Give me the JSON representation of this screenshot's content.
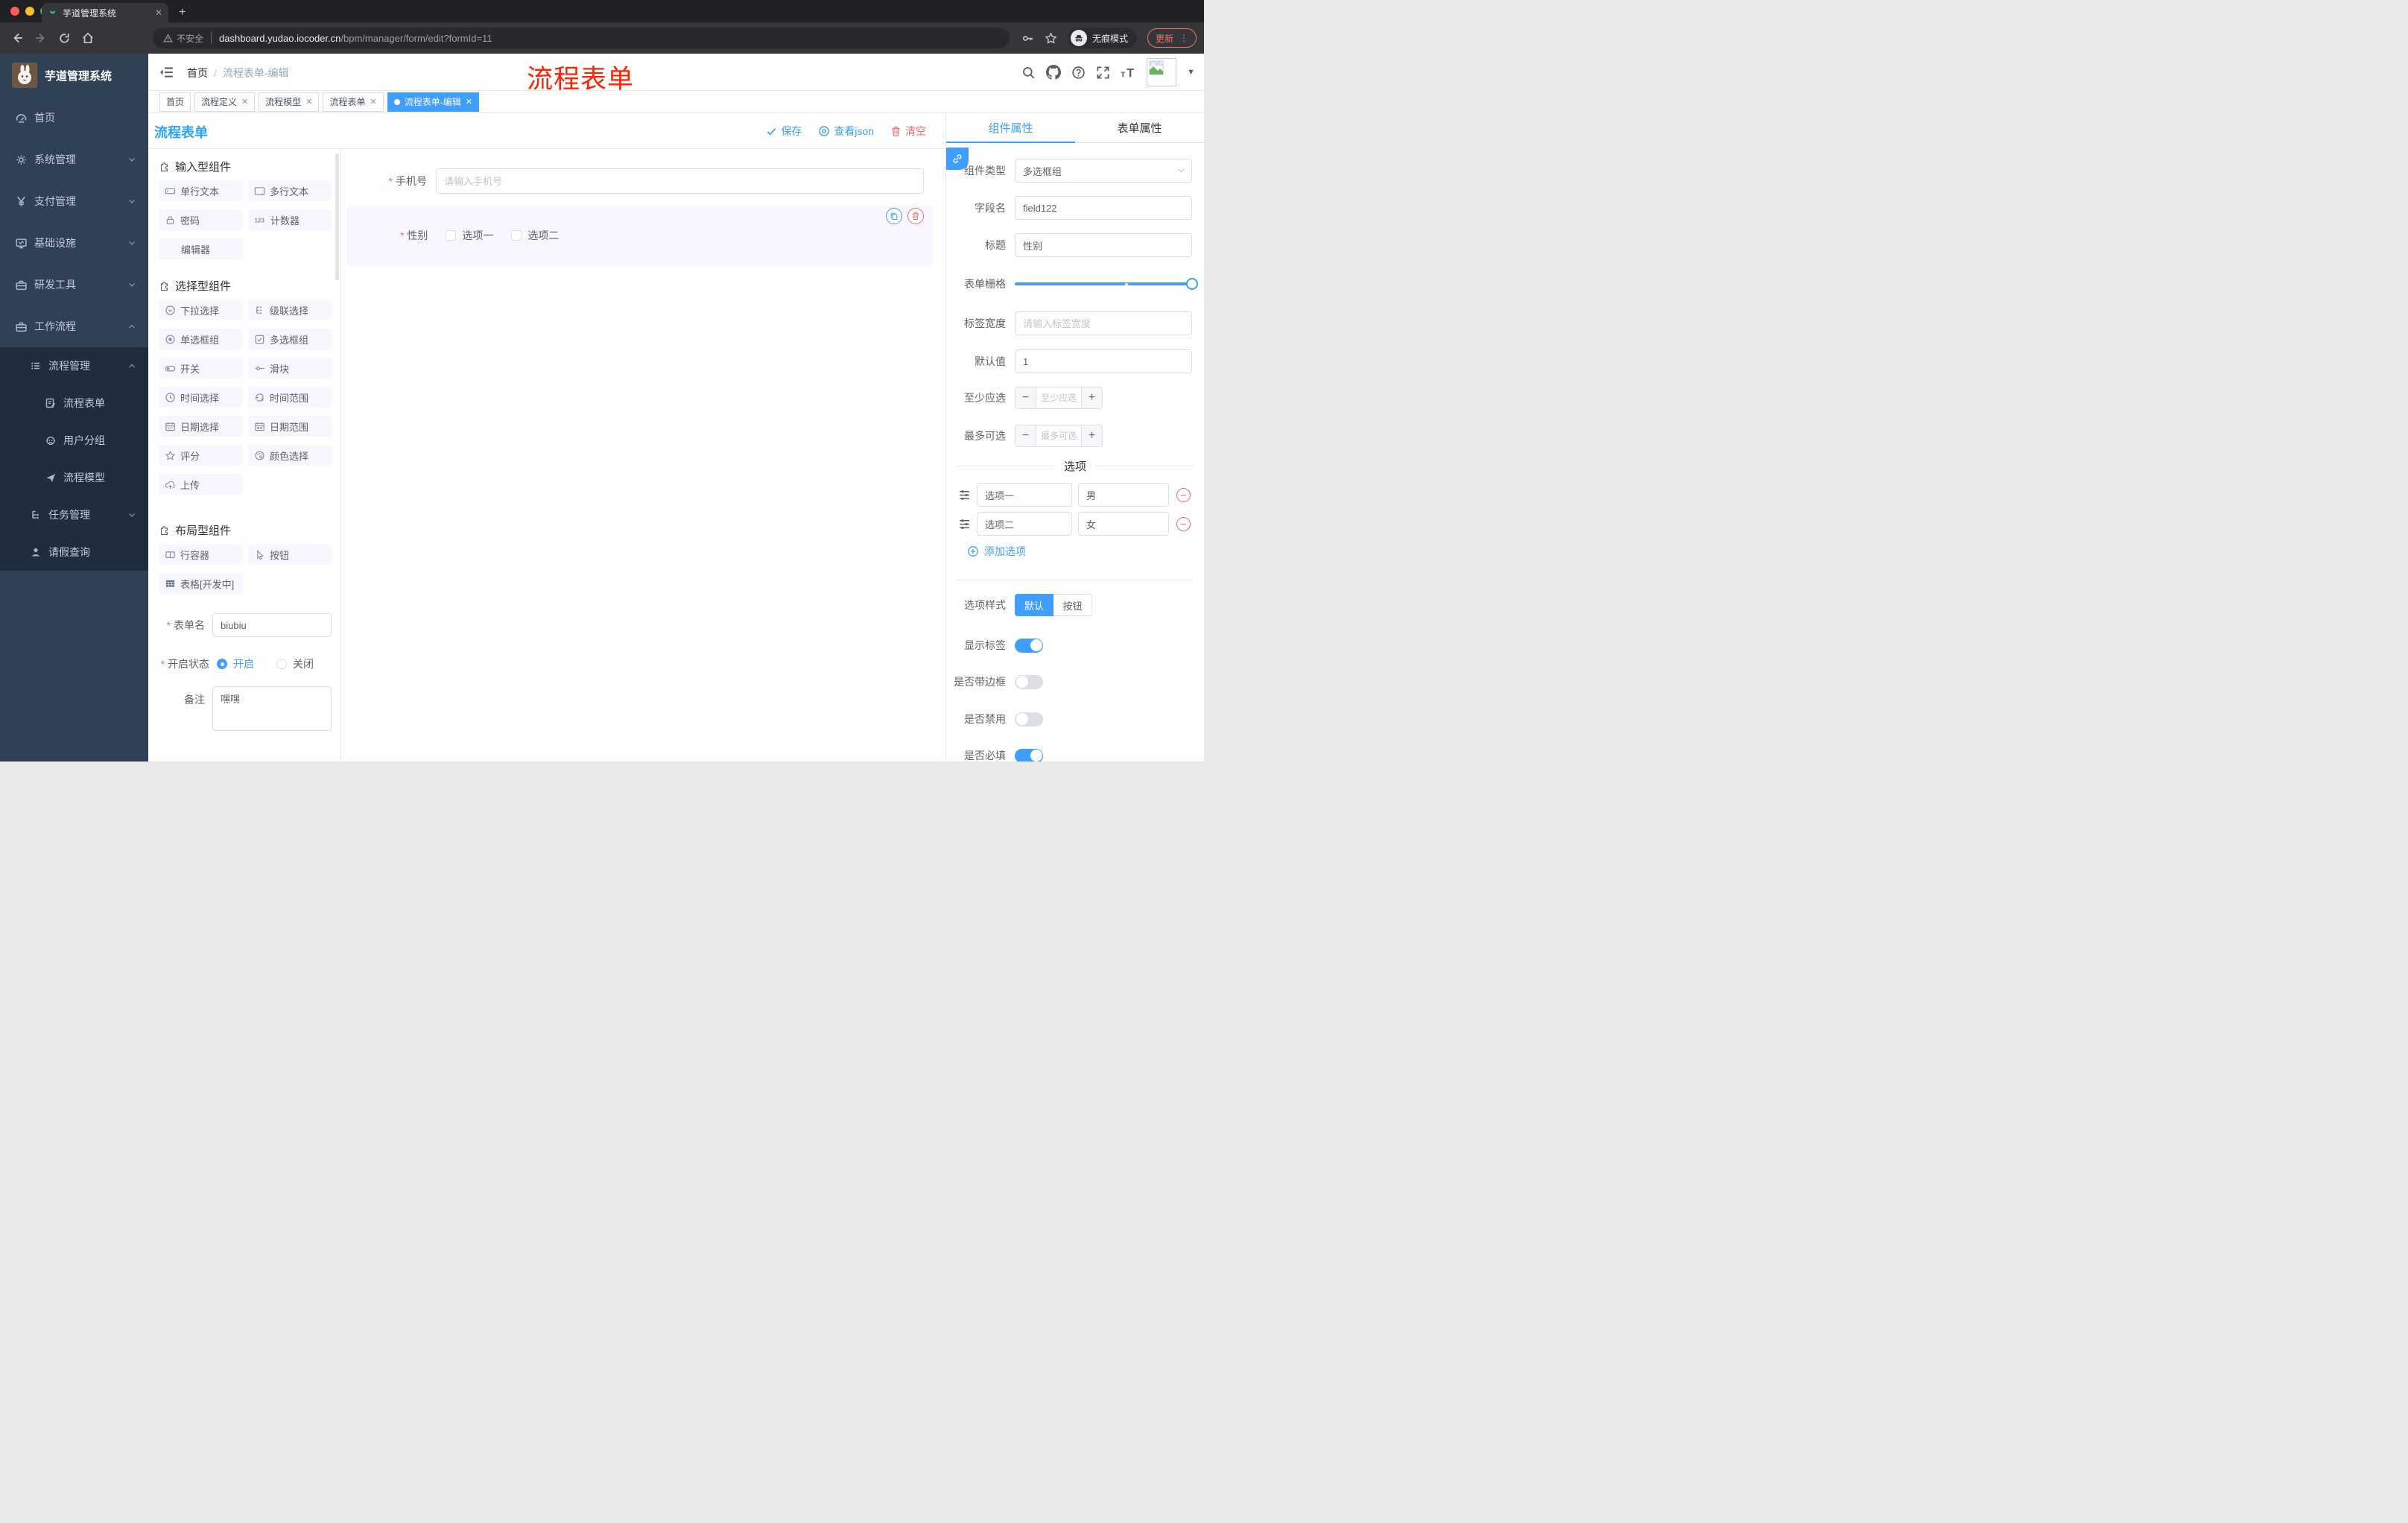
{
  "browser": {
    "tab_title": "芋道管理系统",
    "not_secure": "不安全",
    "url_domain": "dashboard.yudao.iocoder.cn",
    "url_path": "/bpm/manager/form/edit?formId=11",
    "incognito": "无痕模式",
    "update": "更新"
  },
  "sidebar": {
    "app_title": "芋道管理系统",
    "menu": [
      {
        "label": "首页"
      },
      {
        "label": "系统管理"
      },
      {
        "label": "支付管理"
      },
      {
        "label": "基础设施"
      },
      {
        "label": "研发工具"
      },
      {
        "label": "工作流程"
      },
      {
        "label": "流程管理"
      },
      {
        "label": "流程表单"
      },
      {
        "label": "用户分组"
      },
      {
        "label": "流程模型"
      },
      {
        "label": "任务管理"
      },
      {
        "label": "请假查询"
      }
    ]
  },
  "header": {
    "breadcrumb_home": "首页",
    "breadcrumb_current": "流程表单-编辑",
    "annotation": "流程表单"
  },
  "tags": [
    {
      "label": "首页"
    },
    {
      "label": "流程定义"
    },
    {
      "label": "流程模型"
    },
    {
      "label": "流程表单"
    },
    {
      "label": "流程表单-编辑"
    }
  ],
  "toolbar": {
    "title": "流程表单",
    "save": "保存",
    "view_json": "查看json",
    "clear": "清空"
  },
  "components": {
    "section_input": "输入型组件",
    "section_select": "选择型组件",
    "section_layout": "布局型组件",
    "input_items": [
      "单行文本",
      "多行文本",
      "密码",
      "计数器",
      "编辑器"
    ],
    "select_items": [
      "下拉选择",
      "级联选择",
      "单选框组",
      "多选框组",
      "开关",
      "滑块",
      "时间选择",
      "时间范围",
      "日期选择",
      "日期范围",
      "评分",
      "颜色选择",
      "上传"
    ],
    "layout_items": [
      "行容器",
      "按钮",
      "表格[开发中]"
    ]
  },
  "form_meta": {
    "name_label": "表单名",
    "name_value": "biubiu",
    "status_label": "开启状态",
    "status_on": "开启",
    "status_off": "关闭",
    "remark_label": "备注",
    "remark_value": "嘿嘿"
  },
  "canvas": {
    "phone_label": "手机号",
    "phone_placeholder": "请输入手机号",
    "gender_label": "性别",
    "gender_options": [
      "选项一",
      "选项二"
    ]
  },
  "props": {
    "tab_component": "组件属性",
    "tab_form": "表单属性",
    "type_label": "组件类型",
    "type_value": "多选框组",
    "field_label": "字段名",
    "field_value": "field122",
    "title_label": "标题",
    "title_value": "性别",
    "grid_label": "表单栅格",
    "label_width_label": "标签宽度",
    "label_width_placeholder": "请输入标签宽度",
    "default_label": "默认值",
    "default_value": "1",
    "min_label": "至少应选",
    "min_placeholder": "至少应选",
    "max_label": "最多可选",
    "max_placeholder": "最多可选",
    "options_title": "选项",
    "options": [
      {
        "label": "选项一",
        "value": "男"
      },
      {
        "label": "选项二",
        "value": "女"
      }
    ],
    "add_option": "添加选项",
    "style_label": "选项样式",
    "style_default": "默认",
    "style_button": "按钮",
    "show_label": "显示标签",
    "border_label": "是否带边框",
    "disabled_label": "是否禁用",
    "required_label": "是否必填"
  },
  "colors": {
    "accent": "#409eff",
    "danger": "#f56c6c",
    "annotation": "#ff2200"
  }
}
